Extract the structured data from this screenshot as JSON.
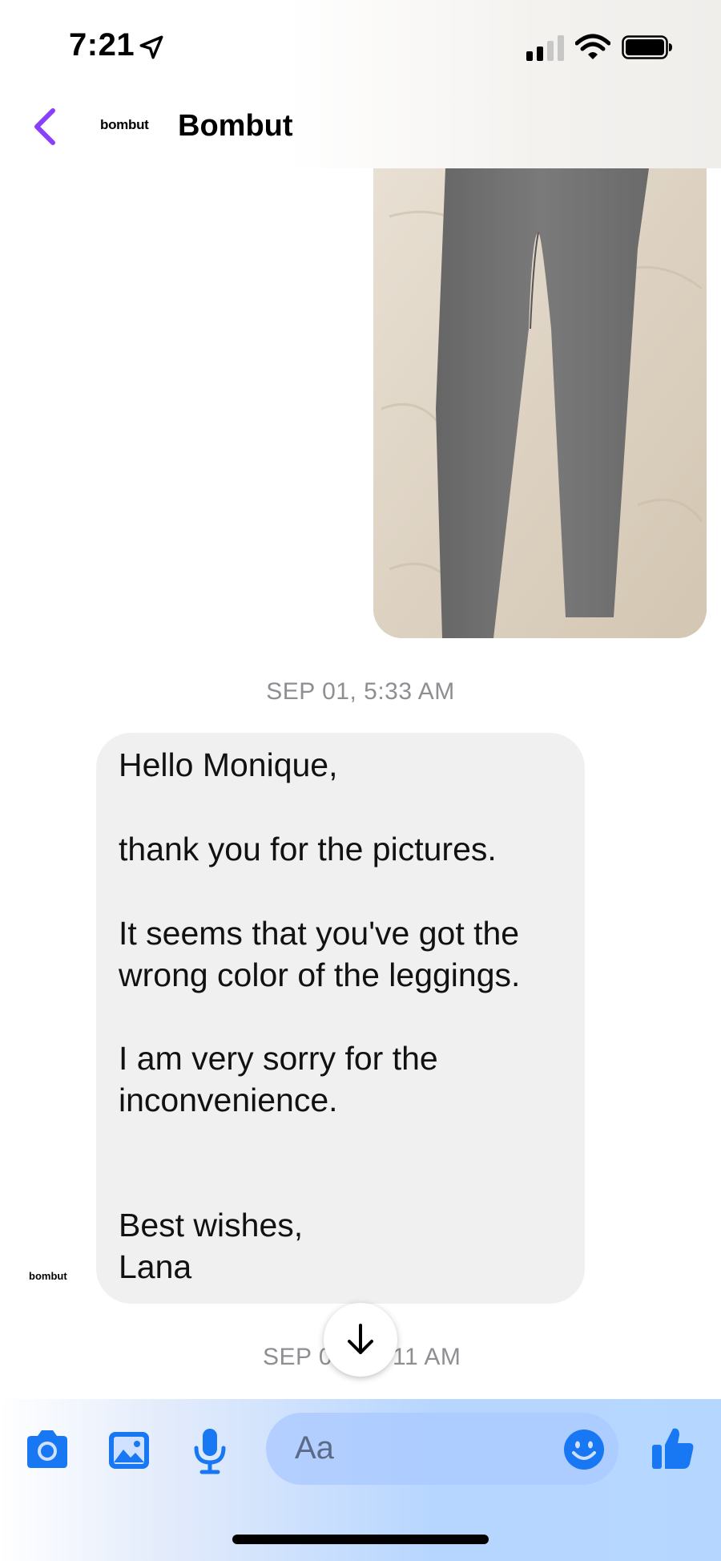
{
  "status_bar": {
    "time": "7:21"
  },
  "header": {
    "brand_logo_text": "bombut",
    "title": "Bombut"
  },
  "messages": {
    "timestamp_1": "SEP 01, 5:33 AM",
    "bubble_lines": [
      "Hello Monique,",
      "thank you for the pictures.",
      "It seems that you've got the",
      "wrong color of the leggings.",
      "I am very sorry for the",
      "inconvenience.",
      "Best wishes,",
      "Lana"
    ],
    "sender_logo_text": "bombut",
    "timestamp_2_left": "SEP 0",
    "timestamp_2_right": "11 AM"
  },
  "composer": {
    "placeholder": "Aa"
  },
  "colors": {
    "accent_purple": "#8a3ffc",
    "messenger_blue": "#1877f2",
    "bubble_gray": "#f0f0f0"
  },
  "icons": [
    "location-arrow-icon",
    "signal-icon",
    "wifi-icon",
    "battery-icon",
    "back-chevron-icon",
    "arrow-down-icon",
    "camera-icon",
    "image-icon",
    "microphone-icon",
    "emoji-icon",
    "thumbs-up-icon"
  ]
}
